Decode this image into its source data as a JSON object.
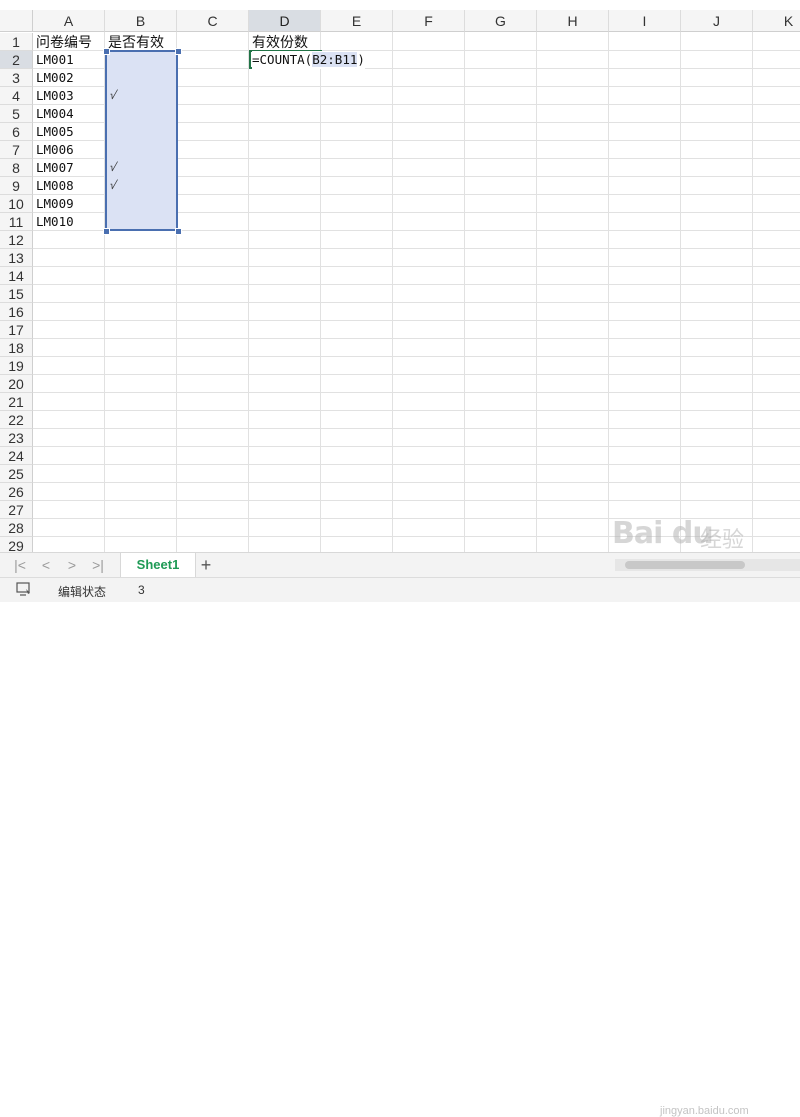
{
  "columns": [
    "A",
    "B",
    "C",
    "D",
    "E",
    "F",
    "G",
    "H",
    "I",
    "J",
    "K"
  ],
  "active_column": "D",
  "rows": [
    "1",
    "2",
    "3",
    "4",
    "5",
    "6",
    "7",
    "8",
    "9",
    "10",
    "11",
    "12",
    "13",
    "14",
    "15",
    "16",
    "17",
    "18",
    "19",
    "20",
    "21",
    "22",
    "23",
    "24",
    "25",
    "26",
    "27",
    "28",
    "29"
  ],
  "active_row": "2",
  "header_a": "问卷编号",
  "header_b": "是否有效",
  "header_d": "有效份数",
  "ids": [
    "LM001",
    "LM002",
    "LM003",
    "LM004",
    "LM005",
    "LM006",
    "LM007",
    "LM008",
    "LM009",
    "LM010"
  ],
  "checks": [
    {
      "row": 4,
      "mark": "√"
    },
    {
      "row": 8,
      "mark": "√"
    },
    {
      "row": 9,
      "mark": "√"
    }
  ],
  "formula": {
    "prefix": "=COUNTA(",
    "ref": "B2:B11",
    "suffix": ")"
  },
  "sheet_tab": "Sheet1",
  "add_sheet": "+",
  "nav": {
    "first": "|<",
    "prev": "<",
    "next": ">",
    "last": ">|"
  },
  "status": {
    "label": "编辑状态",
    "count": "3"
  },
  "watermark": {
    "main": "Bai du",
    "jy": "经验",
    "sub": "jingyan.baidu.com"
  },
  "colors": {
    "accent": "#1e9a55",
    "selection": "#dbe2f4",
    "selection_border": "#4a6fb0",
    "active_cell_border": "#217346"
  }
}
